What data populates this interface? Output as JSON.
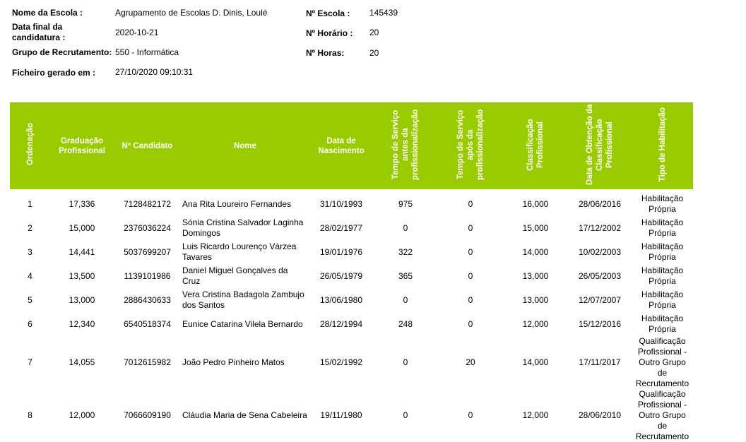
{
  "header": {
    "escola_label": "Nome da Escola :",
    "escola_value": "Agrupamento de Escolas D. Dinis, Loulé",
    "data_final_label": "Data final da candidatura :",
    "data_final_value": "2020-10-21",
    "grupo_label": "Grupo de Recrutamento:",
    "grupo_value": "550 - Informática",
    "ficheiro_label": "Ficheiro gerado em :",
    "ficheiro_value": "27/10/2020 09:10:31",
    "num_escola_label": "Nº Escola :",
    "num_escola_value": "145439",
    "num_horario_label": "Nº Horário :",
    "num_horario_value": "20",
    "num_horas_label": "Nº Horas:",
    "num_horas_value": "20"
  },
  "table": {
    "columns": [
      "Ordenação",
      "Graduação Profissional",
      "Nº Candidato",
      "Nome",
      "Data de Nascimento",
      "Tempo de Serviço antes da profissionalização",
      "Tempo de Serviço após da profissionalização",
      "Classificação Profissional",
      "Data de Obtenção da Classificação Profissional",
      "Tipo de Habilitação"
    ],
    "rows": [
      [
        "1",
        "17,336",
        "7128482172",
        "Ana Rita Loureiro Fernandes",
        "31/10/1993",
        "975",
        "0",
        "16,000",
        "28/06/2016",
        "Habilitação Própria"
      ],
      [
        "2",
        "15,000",
        "2376036224",
        "Sónia Cristina Salvador Laginha Domingos",
        "28/02/1977",
        "0",
        "0",
        "15,000",
        "17/12/2002",
        "Habilitação Própria"
      ],
      [
        "3",
        "14,441",
        "5037699207",
        "Luis Ricardo Lourenço Várzea Tavares",
        "19/01/1976",
        "322",
        "0",
        "14,000",
        "10/02/2003",
        "Habilitação Própria"
      ],
      [
        "4",
        "13,500",
        "1139101986",
        "Daniel Miguel Gonçalves da Cruz",
        "26/05/1979",
        "365",
        "0",
        "13,000",
        "26/05/2003",
        "Habilitação Própria"
      ],
      [
        "5",
        "13,000",
        "2886430633",
        "Vera Cristina Badagola Zambujo dos Santos",
        "13/06/1980",
        "0",
        "0",
        "13,000",
        "12/07/2007",
        "Habilitação Própria"
      ],
      [
        "6",
        "12,340",
        "6540518374",
        "Eunice Catarina Vilela Bernardo",
        "28/12/1994",
        "248",
        "0",
        "12,000",
        "15/12/2016",
        "Habilitação Própria"
      ],
      [
        "7",
        "14,055",
        "7012615982",
        "João Pedro Pinheiro Matos",
        "15/02/1992",
        "0",
        "20",
        "14,000",
        "17/11/2017",
        "Qualificação Profissional - Outro Grupo de Recrutamento"
      ],
      [
        "8",
        "12,000",
        "7066609190",
        "Cláudia Maria de Sena Cabeleira",
        "19/11/1980",
        "0",
        "0",
        "12,000",
        "28/06/2010",
        "Qualificação Profissional - Outro Grupo de Recrutamento"
      ]
    ]
  }
}
